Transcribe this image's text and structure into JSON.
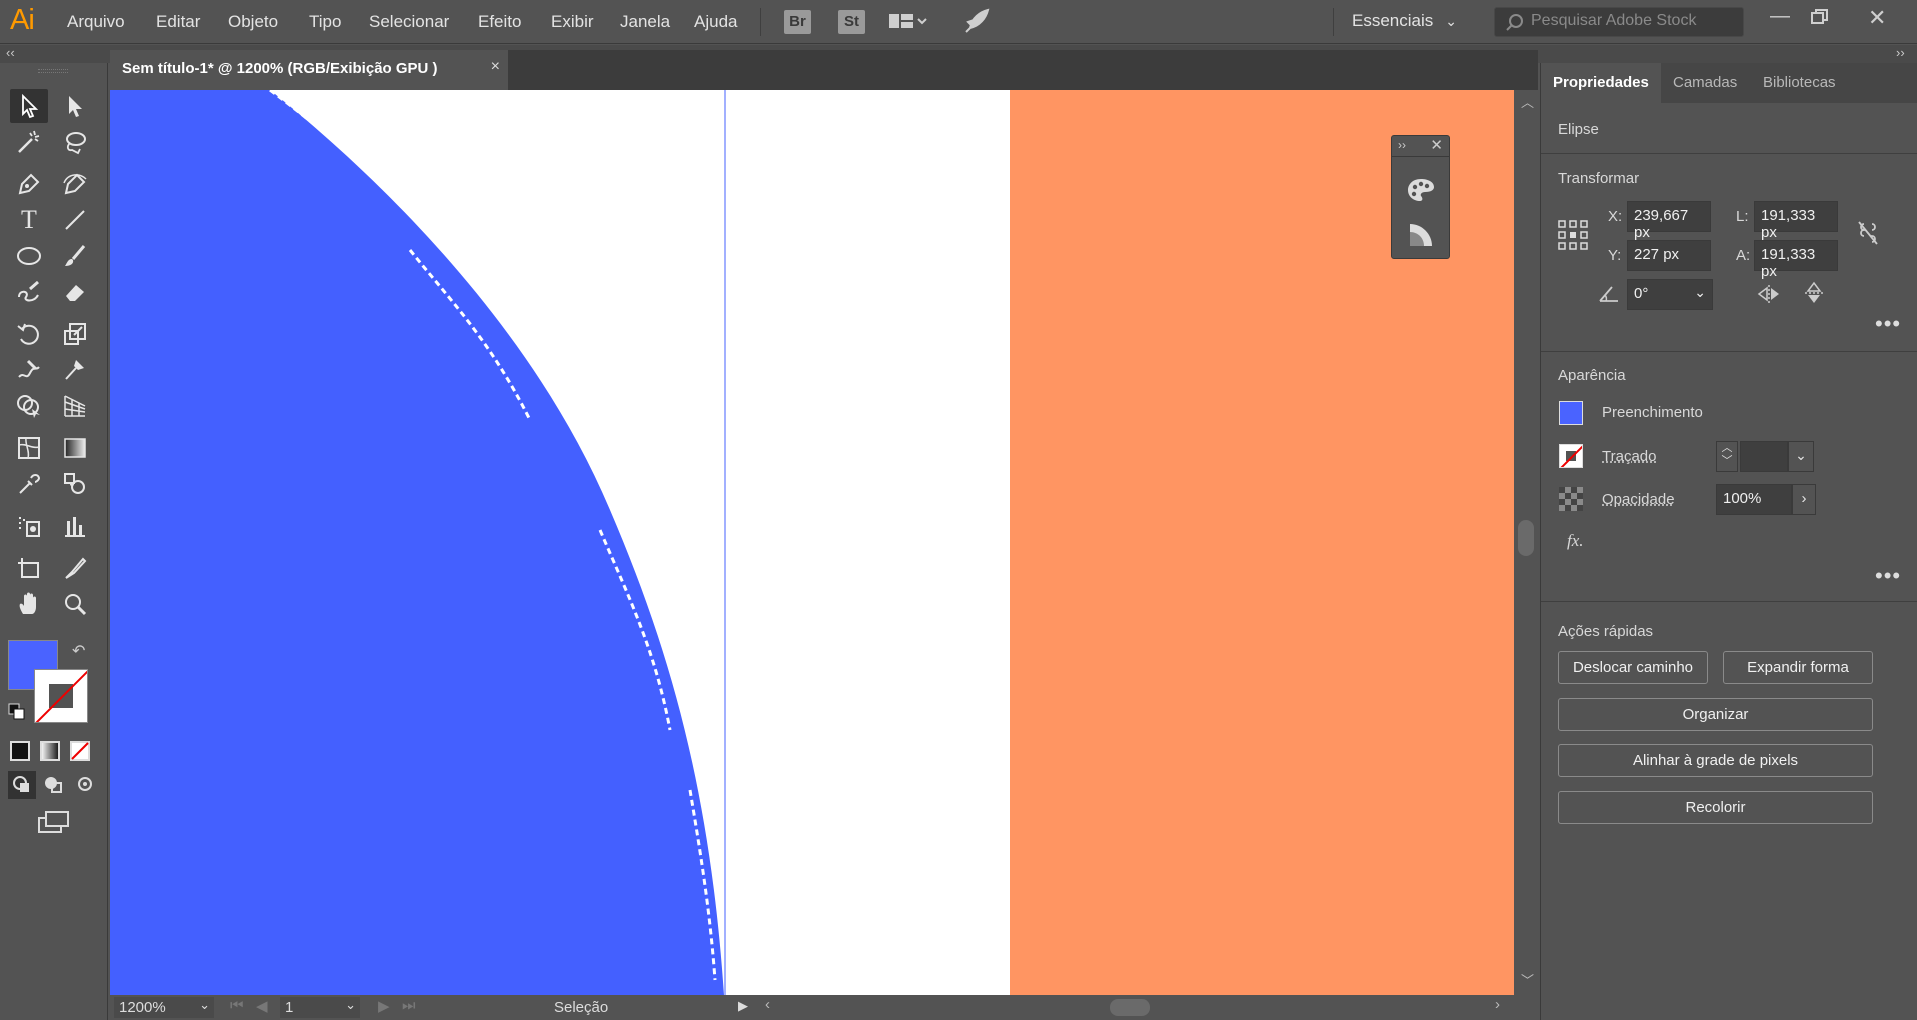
{
  "app": {
    "logo": "Ai",
    "menu": [
      "Arquivo",
      "Editar",
      "Objeto",
      "Tipo",
      "Selecionar",
      "Efeito",
      "Exibir",
      "Janela",
      "Ajuda"
    ],
    "badges": [
      "Br",
      "St"
    ],
    "workspace": "Essenciais",
    "stock_search_placeholder": "Pesquisar Adobe Stock",
    "accent_color": "#ff9a00"
  },
  "document": {
    "tab_title": "Sem título-1* @ 1200% (RGB/Exibição GPU )",
    "close_glyph": "×"
  },
  "canvas": {
    "shape_fill": "#4460ff",
    "orange_fill": "#ff9562"
  },
  "status": {
    "zoom": "1200%",
    "artboard": "1",
    "tool": "Seleção"
  },
  "panel": {
    "tabs": [
      "Propriedades",
      "Camadas",
      "Bibliotecas"
    ],
    "object_type": "Elipse",
    "transform": {
      "title": "Transformar",
      "x_label": "X:",
      "x": "239,667 px",
      "y_label": "Y:",
      "y": "227 px",
      "w_label": "L:",
      "w": "191,333 px",
      "h_label": "A:",
      "h": "191,333 px",
      "angle": "0°"
    },
    "appearance": {
      "title": "Aparência",
      "fill_label": "Preenchimento",
      "stroke_label": "Traçado",
      "opacity_label": "Opacidade",
      "opacity": "100%",
      "fx": "fx.",
      "fill_color": "#4a63ff"
    },
    "quick_actions": {
      "title": "Ações rápidas",
      "offset_path": "Deslocar caminho",
      "expand_shape": "Expandir forma",
      "arrange": "Organizar",
      "align_pixel": "Alinhar à grade de pixels",
      "recolor": "Recolorir"
    }
  }
}
